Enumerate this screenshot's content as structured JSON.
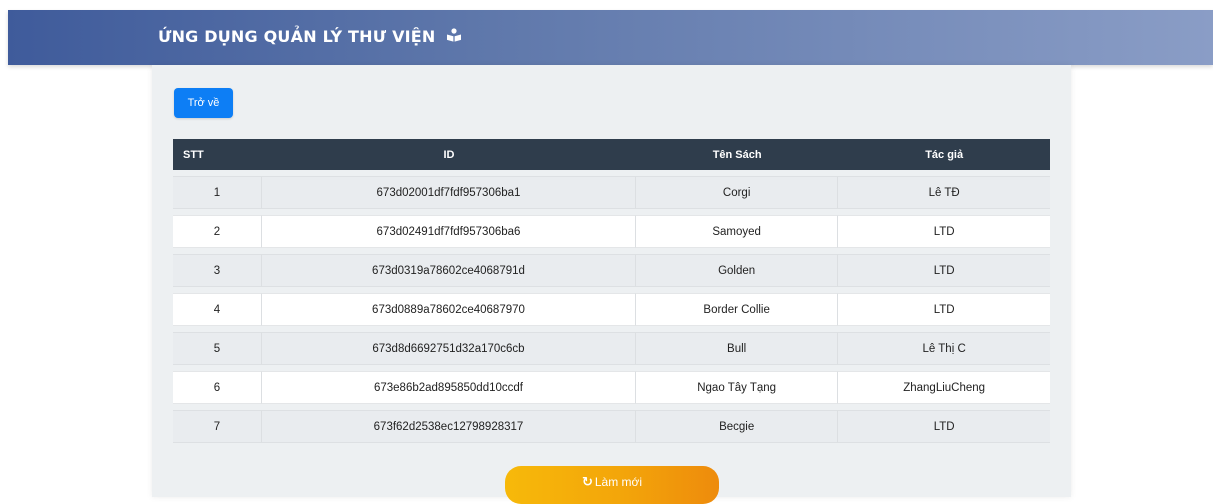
{
  "header": {
    "title": "ỨNG DỤNG QUẢN LÝ THƯ VIỆN",
    "icon": "book-reader-icon"
  },
  "back_button": {
    "label": "Trở về"
  },
  "table": {
    "columns": [
      "STT",
      "ID",
      "Tên Sách",
      "Tác giả"
    ],
    "rows": [
      {
        "stt": "1",
        "id": "673d02001df7fdf957306ba1",
        "name": "Corgi",
        "author": "Lê TĐ"
      },
      {
        "stt": "2",
        "id": "673d02491df7fdf957306ba6",
        "name": "Samoyed",
        "author": "LTD"
      },
      {
        "stt": "3",
        "id": "673d0319a78602ce4068791d",
        "name": "Golden",
        "author": "LTD"
      },
      {
        "stt": "4",
        "id": "673d0889a78602ce40687970",
        "name": "Border Collie",
        "author": "LTD"
      },
      {
        "stt": "5",
        "id": "673d8d6692751d32a170c6cb",
        "name": "Bull",
        "author": "Lê Thị C"
      },
      {
        "stt": "6",
        "id": "673e86b2ad895850dd10ccdf",
        "name": "Ngao Tây Tạng",
        "author": "ZhangLiuCheng"
      },
      {
        "stt": "7",
        "id": "673f62d2538ec12798928317",
        "name": "Becgie",
        "author": "LTD"
      }
    ]
  },
  "refresh_button": {
    "label": "Làm mới",
    "icon": "refresh-icon"
  },
  "colors": {
    "header_start": "#3f5b9b",
    "header_end": "#8a9dc6",
    "primary_button": "#0d7ef5",
    "table_header": "#2f3d4c",
    "refresh_button": "#f3a50a"
  }
}
